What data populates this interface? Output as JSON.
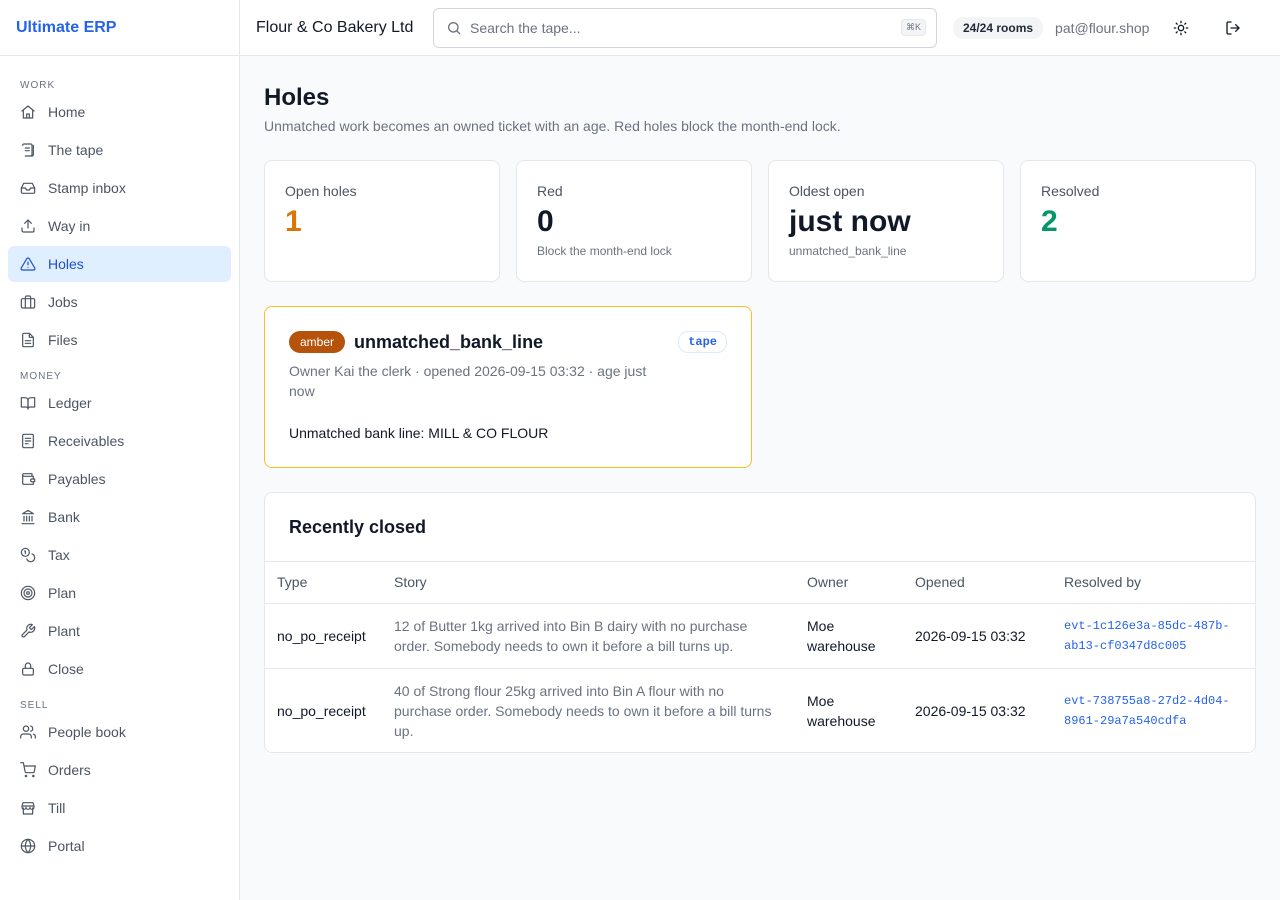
{
  "app": {
    "brand": "Ultimate ERP"
  },
  "topbar": {
    "company": "Flour & Co Bakery Ltd",
    "search_placeholder": "Search the tape...",
    "search_shortcut": "⌘K",
    "rooms": "24/24 rooms",
    "user_email": "pat@flour.shop"
  },
  "sidebar": {
    "sections": [
      {
        "label": "WORK",
        "items": [
          {
            "label": "Home",
            "icon": "home-icon"
          },
          {
            "label": "The tape",
            "icon": "scroll-icon"
          },
          {
            "label": "Stamp inbox",
            "icon": "inbox-icon"
          },
          {
            "label": "Way in",
            "icon": "upload-icon"
          },
          {
            "label": "Holes",
            "icon": "alert-triangle-icon",
            "active": true
          },
          {
            "label": "Jobs",
            "icon": "briefcase-icon"
          },
          {
            "label": "Files",
            "icon": "file-icon"
          }
        ]
      },
      {
        "label": "MONEY",
        "items": [
          {
            "label": "Ledger",
            "icon": "book-icon"
          },
          {
            "label": "Receivables",
            "icon": "receipt-icon"
          },
          {
            "label": "Payables",
            "icon": "wallet-icon"
          },
          {
            "label": "Bank",
            "icon": "bank-icon"
          },
          {
            "label": "Tax",
            "icon": "coins-icon"
          },
          {
            "label": "Plan",
            "icon": "target-icon"
          },
          {
            "label": "Plant",
            "icon": "wrench-icon"
          },
          {
            "label": "Close",
            "icon": "lock-icon"
          }
        ]
      },
      {
        "label": "SELL",
        "items": [
          {
            "label": "People book",
            "icon": "users-icon"
          },
          {
            "label": "Orders",
            "icon": "cart-icon"
          },
          {
            "label": "Till",
            "icon": "store-icon"
          },
          {
            "label": "Portal",
            "icon": "globe-icon"
          }
        ]
      }
    ]
  },
  "page": {
    "title": "Holes",
    "subtitle": "Unmatched work becomes an owned ticket with an age. Red holes block the month-end lock."
  },
  "stats": [
    {
      "label": "Open holes",
      "value": "1",
      "hint": "",
      "color": "#d97706"
    },
    {
      "label": "Red",
      "value": "0",
      "hint": "Block the month-end lock",
      "color": "#111827"
    },
    {
      "label": "Oldest open",
      "value": "just now",
      "hint": "unmatched_bank_line",
      "color": "#111827"
    },
    {
      "label": "Resolved",
      "value": "2",
      "hint": "",
      "color": "#059669"
    }
  ],
  "hole": {
    "severity": "amber",
    "name": "unmatched_bank_line",
    "source_tag": "tape",
    "meta": "Owner Kai the clerk · opened 2026-09-15 03:32 · age just now",
    "description": "Unmatched bank line: MILL & CO FLOUR"
  },
  "closed": {
    "title": "Recently closed",
    "columns": [
      "Type",
      "Story",
      "Owner",
      "Opened",
      "Resolved by"
    ],
    "rows": [
      {
        "type": "no_po_receipt",
        "story": "12 of Butter 1kg arrived into Bin B dairy with no purchase order. Somebody needs to own it before a bill turns up.",
        "owner": "Moe warehouse",
        "opened": "2026-09-15 03:32",
        "resolved_by": "evt-1c126e3a-85dc-487b-ab13-cf0347d8c005"
      },
      {
        "type": "no_po_receipt",
        "story": "40 of Strong flour 25kg arrived into Bin A flour with no purchase order. Somebody needs to own it before a bill turns up.",
        "owner": "Moe warehouse",
        "opened": "2026-09-15 03:32",
        "resolved_by": "evt-738755a8-27d2-4d04-8961-29a7a540cdfa"
      }
    ]
  }
}
